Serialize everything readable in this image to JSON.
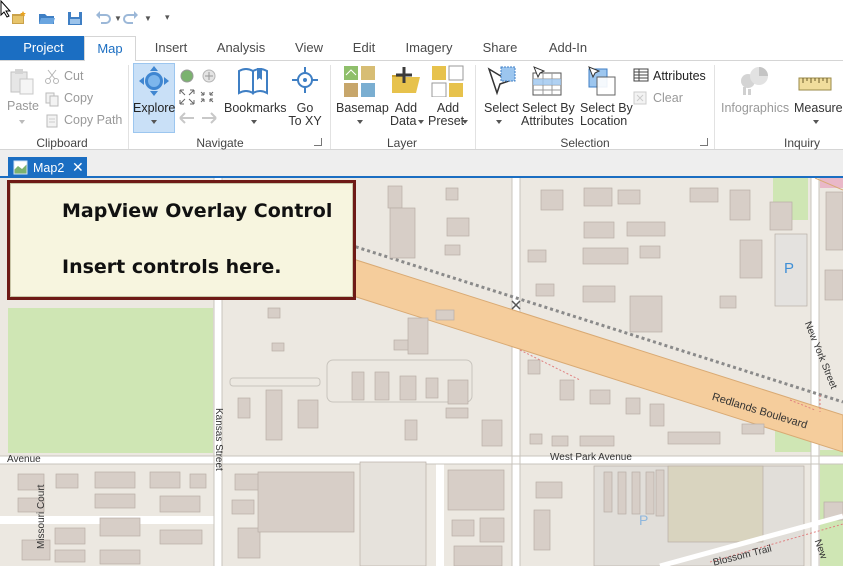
{
  "colors": {
    "accent": "#1b6ec2",
    "overlay_border": "#6e1a16",
    "overlay_bg": "#f7f5df",
    "map_bg": "#ece8e1",
    "road": "#f5cd9c",
    "park": "#cfe6b4"
  },
  "quick_access": {
    "icons": [
      "new-project-icon",
      "open-project-icon",
      "save-project-icon",
      "undo-icon",
      "redo-icon",
      "customize-qat-icon"
    ]
  },
  "ribbon_tabs": {
    "project": "Project",
    "map": "Map",
    "insert": "Insert",
    "analysis": "Analysis",
    "view": "View",
    "edit": "Edit",
    "imagery": "Imagery",
    "share": "Share",
    "addin": "Add-In",
    "active": "Map"
  },
  "groups": {
    "clipboard": {
      "label": "Clipboard",
      "paste": "Paste",
      "cut": "Cut",
      "copy": "Copy",
      "copy_path": "Copy Path"
    },
    "navigate": {
      "label": "Navigate",
      "explore": "Explore",
      "bookmarks": "Bookmarks",
      "go_to_xy_1": "Go",
      "go_to_xy_2": "To XY"
    },
    "layer": {
      "label": "Layer",
      "basemap": "Basemap",
      "add_data_1": "Add",
      "add_data_2": "Data",
      "add_preset_1": "Add",
      "add_preset_2": "Preset"
    },
    "selection": {
      "label": "Selection",
      "select": "Select",
      "select_by_attributes_1": "Select By",
      "select_by_attributes_2": "Attributes",
      "select_by_location_1": "Select By",
      "select_by_location_2": "Location",
      "attributes": "Attributes",
      "clear": "Clear"
    },
    "inquiry": {
      "label": "Inquiry",
      "infographics": "Infographics",
      "measure": "Measure"
    }
  },
  "view_tab": {
    "label": "Map2",
    "close": "✕"
  },
  "overlay": {
    "title": "MapView Overlay Control",
    "subtitle": "Insert controls here."
  },
  "map_labels": {
    "redlands_blvd": "Redlands Boulevard",
    "new_york_street": "New York Street",
    "kansas_street": "Kansas Street",
    "west_park_avenue": "West Park Avenue",
    "avenue": "Avenue",
    "missouri_court": "Missouri Court",
    "blossom_trail": "Blossom Trail",
    "parking_1": "P",
    "parking_2": "P",
    "new_cut": "New"
  }
}
